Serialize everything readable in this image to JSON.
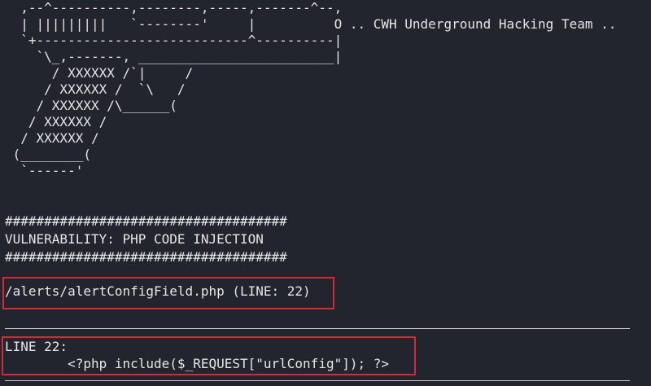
{
  "terminal": {
    "banner_art": [
      "  ,--^----------,--------,-----,-------^--,",
      "  | |||||||||   `--------'     |          O .. CWH Underground Hacking Team ..",
      "  `+---------------------------^----------|",
      "    `\\_,-------, _________________________|",
      "      / XXXXXX /`|     /",
      "     / XXXXXX /  `\\   /",
      "    / XXXXXX /\\______(",
      "   / XXXXXX /",
      "  / XXXXXX /",
      " (________(",
      "  `------'"
    ],
    "separator_top": "####################################",
    "vulnerability_title": "VULNERABILITY: PHP CODE INJECTION",
    "separator_bottom": "####################################",
    "file_location": "/alerts/alertConfigField.php (LINE: 22)",
    "line_label": "LINE 22:",
    "code_snippet": "        <?php include($_REQUEST[\"urlConfig\"]); ?>"
  },
  "colors": {
    "background": "#22242e",
    "text": "#e6e6e6",
    "highlight_border": "#d12c35"
  }
}
